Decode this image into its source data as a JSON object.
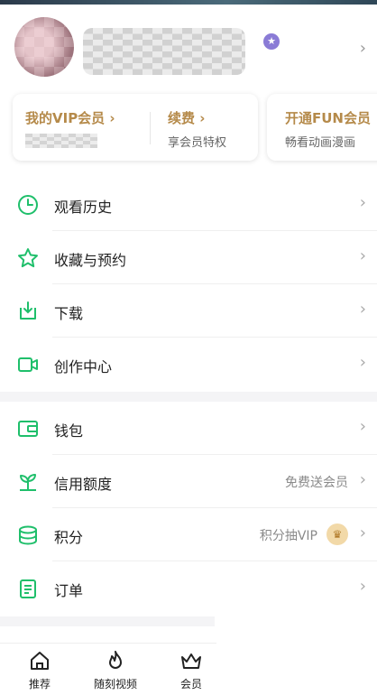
{
  "colors": {
    "accent_green": "#1fbf6b",
    "gold": "#b58a4a"
  },
  "profile": {
    "badge_icon": "hexagon-star-icon"
  },
  "vip": {
    "my_vip_label": "我的VIP会员 ›",
    "renew_label": "续费 ›",
    "renew_sub": "享会员特权",
    "fun_label": "开通FUN会员",
    "fun_sub": "畅看动画漫画"
  },
  "menu1": [
    {
      "label": "观看历史",
      "icon": "clock-icon"
    },
    {
      "label": "收藏与预约",
      "icon": "star-icon"
    },
    {
      "label": "下载",
      "icon": "download-icon"
    },
    {
      "label": "创作中心",
      "icon": "video-camera-icon"
    }
  ],
  "menu2": [
    {
      "label": "钱包",
      "icon": "wallet-icon",
      "right": ""
    },
    {
      "label": "信用额度",
      "icon": "sprout-icon",
      "right": "免费送会员"
    },
    {
      "label": "积分",
      "icon": "coins-stack-icon",
      "right": "积分抽VIP"
    },
    {
      "label": "订单",
      "icon": "clipboard-icon",
      "right": ""
    }
  ],
  "nav": [
    {
      "label": "推荐",
      "icon": "home-icon"
    },
    {
      "label": "随刻视频",
      "icon": "flame-icon"
    },
    {
      "label": "会员",
      "icon": "crown-icon"
    }
  ],
  "chevron": "›"
}
